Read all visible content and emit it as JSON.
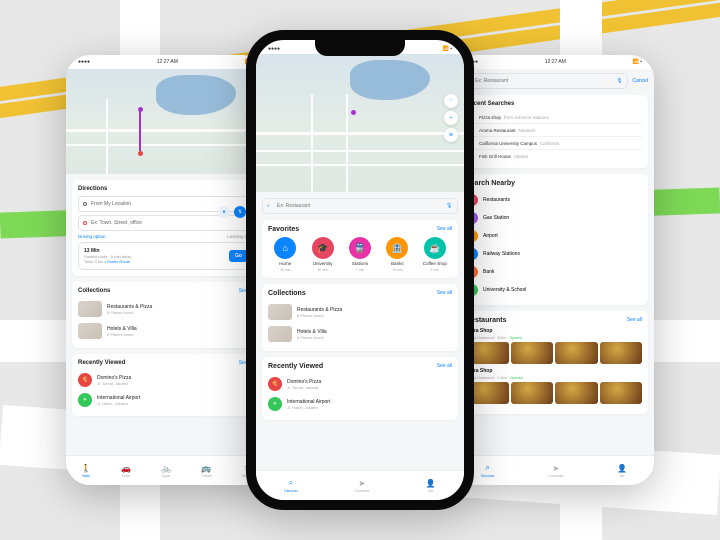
{
  "status": {
    "time": "12:27 AM"
  },
  "search_placeholder": "Ex: Restaurant",
  "cancel": "Cancel",
  "directions": {
    "title": "Directions",
    "from": "From My Location",
    "to": "Ex: Town, Street, office",
    "driving_option": "Driving option",
    "leaving": "Leaving soon",
    "trip_time": "13 Min",
    "trip_sub": "Fastest route · 5 min delay",
    "trip_dist": "Total: 5 km",
    "go": "Go",
    "faster": "• Faster Route"
  },
  "favorites": {
    "title": "Favorites",
    "see_all": "See all",
    "items": [
      {
        "icon": "home",
        "label": "Home",
        "sub": "15 min"
      },
      {
        "icon": "school",
        "label": "University",
        "sub": "30 min"
      },
      {
        "icon": "train",
        "label": "Stations",
        "sub": "7 min"
      },
      {
        "icon": "bank",
        "label": "Banks",
        "sub": "10 min"
      },
      {
        "icon": "coffee",
        "label": "Coffee shop",
        "sub": "5 min"
      }
    ]
  },
  "collections": {
    "title": "Collections",
    "see_all": "See all",
    "items": [
      {
        "title": "Restaurants & Pizza",
        "sub": "8 Places found"
      },
      {
        "title": "Hotels & Villa",
        "sub": "6 Places found"
      }
    ]
  },
  "recently": {
    "title": "Recently Viewed",
    "see_all": "See all",
    "items": [
      {
        "title": "Domino's Pizza",
        "sub": "Jl. Tomat, Jakarta",
        "color": "red"
      },
      {
        "title": "International Airport",
        "sub": "Jl. Halim, Jakarta",
        "color": "green"
      }
    ]
  },
  "recent_searches": {
    "title": "Recent Searches",
    "items": [
      {
        "q": "Pizza shop",
        "sub": "from Johnson Stations"
      },
      {
        "q": "Aroma Restaurant",
        "sub": "Newport"
      },
      {
        "q": "California University Campus",
        "sub": "California"
      },
      {
        "q": "Fish Grill House",
        "sub": "Atlanta"
      }
    ]
  },
  "search_nearby": {
    "title": "Search Nearby",
    "items": [
      {
        "label": "Restaurants"
      },
      {
        "label": "Gas Station"
      },
      {
        "label": "Airport"
      },
      {
        "label": "Railway Stations"
      },
      {
        "label": "Bank"
      },
      {
        "label": "University & School"
      }
    ]
  },
  "restaurants": {
    "title": "Restaurants",
    "see_all": "See all",
    "items": [
      {
        "title": "Pizza Shop",
        "sub": "Aroma Restaurant · 800m",
        "status": "Opened"
      },
      {
        "title": "Pizza Shop",
        "sub": "Aroma Restaurant · 1.2km",
        "status": "Opened"
      }
    ]
  },
  "tabs": {
    "left": [
      {
        "icon": "walk",
        "label": "Walk"
      },
      {
        "icon": "car",
        "label": "Drive"
      },
      {
        "icon": "bike",
        "label": "Cycle"
      },
      {
        "icon": "bus",
        "label": "Transit"
      },
      {
        "icon": "share",
        "label": "Share"
      }
    ],
    "center": [
      {
        "icon": "search",
        "label": "Discover"
      },
      {
        "icon": "nav",
        "label": "Commute"
      },
      {
        "icon": "user",
        "label": "Me"
      }
    ],
    "right": [
      {
        "icon": "search",
        "label": "Discover"
      },
      {
        "icon": "nav",
        "label": "Commute"
      },
      {
        "icon": "user",
        "label": "Me"
      }
    ]
  },
  "icons": {
    "search": "⌕",
    "mic": "🎤",
    "heart": "♡",
    "plus": "+",
    "compass": "⊕",
    "swap": "⇅",
    "recent": "↻",
    "home": "⌂",
    "school": "🎓",
    "train": "🚆",
    "bank": "🏦",
    "coffee": "☕",
    "pizza": "🍕",
    "plane": "✈",
    "gas": "⛽",
    "walk": "🚶",
    "car": "🚗",
    "bike": "🚲",
    "bus": "🚌",
    "nav": "➤",
    "user": "👤",
    "share": "⇪"
  }
}
